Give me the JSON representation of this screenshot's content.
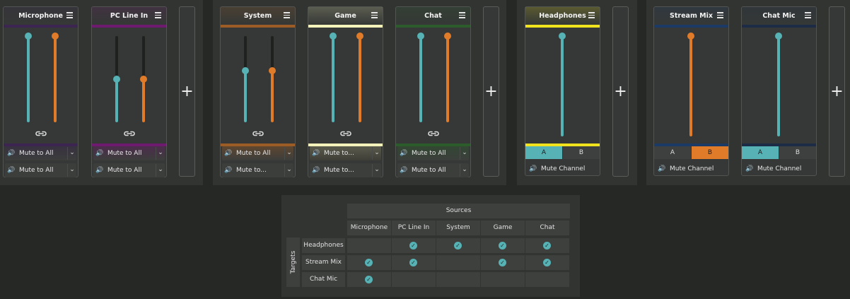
{
  "colors": {
    "volume_teal": "#56b2b4",
    "volume_orange": "#e07b2a",
    "background": "#262826",
    "panel": "#323432"
  },
  "strips": [
    {
      "name": "Microphone",
      "bar_color": "#3c2550",
      "vol1": 1.0,
      "vol2": 1.0,
      "row1": "Mute to All",
      "row2": "Mute to All"
    },
    {
      "name": "PC Line In",
      "bar_color": "#6e1a6e",
      "vol1": 0.5,
      "vol2": 0.5,
      "row1": "Mute to All",
      "row2": "Mute to All"
    },
    {
      "name": "System",
      "bar_color": "#9c5c26",
      "vol1": 0.6,
      "vol2": 0.6,
      "row1": "Mute to All",
      "row2": "Mute to..."
    },
    {
      "name": "Game",
      "bar_color": "#f3f2ba",
      "vol1": 1.0,
      "vol2": 1.0,
      "row1": "Mute to...",
      "row2": "Mute to..."
    },
    {
      "name": "Chat",
      "bar_color": "#2c5c2c",
      "vol1": 1.0,
      "vol2": 1.0,
      "row1": "Mute to All",
      "row2": "Mute to All"
    }
  ],
  "outputs": [
    {
      "name": "Headphones",
      "bar_color": "#f0e21c",
      "vol": 1.0,
      "a": "A",
      "b": "B",
      "mute": "Mute Channel"
    },
    {
      "name": "Stream Mix",
      "bar_color": "#1c3a66",
      "vol": 1.0,
      "a": "A",
      "b": "B",
      "mute": "Mute Channel"
    },
    {
      "name": "Chat Mic",
      "bar_color": "#1c2c46",
      "vol": 1.0,
      "a": "A",
      "b": "B",
      "mute": "Mute Channel"
    }
  ],
  "add_label": "+",
  "matrix": {
    "sources_label": "Sources",
    "targets_label": "Targets",
    "columns": [
      "Microphone",
      "PC Line In",
      "System",
      "Game",
      "Chat"
    ],
    "rows": [
      {
        "name": "Headphones",
        "checks": [
          false,
          true,
          true,
          true,
          true
        ]
      },
      {
        "name": "Stream Mix",
        "checks": [
          true,
          true,
          false,
          true,
          true
        ]
      },
      {
        "name": "Chat Mic",
        "checks": [
          true,
          false,
          false,
          false,
          false
        ]
      }
    ]
  }
}
